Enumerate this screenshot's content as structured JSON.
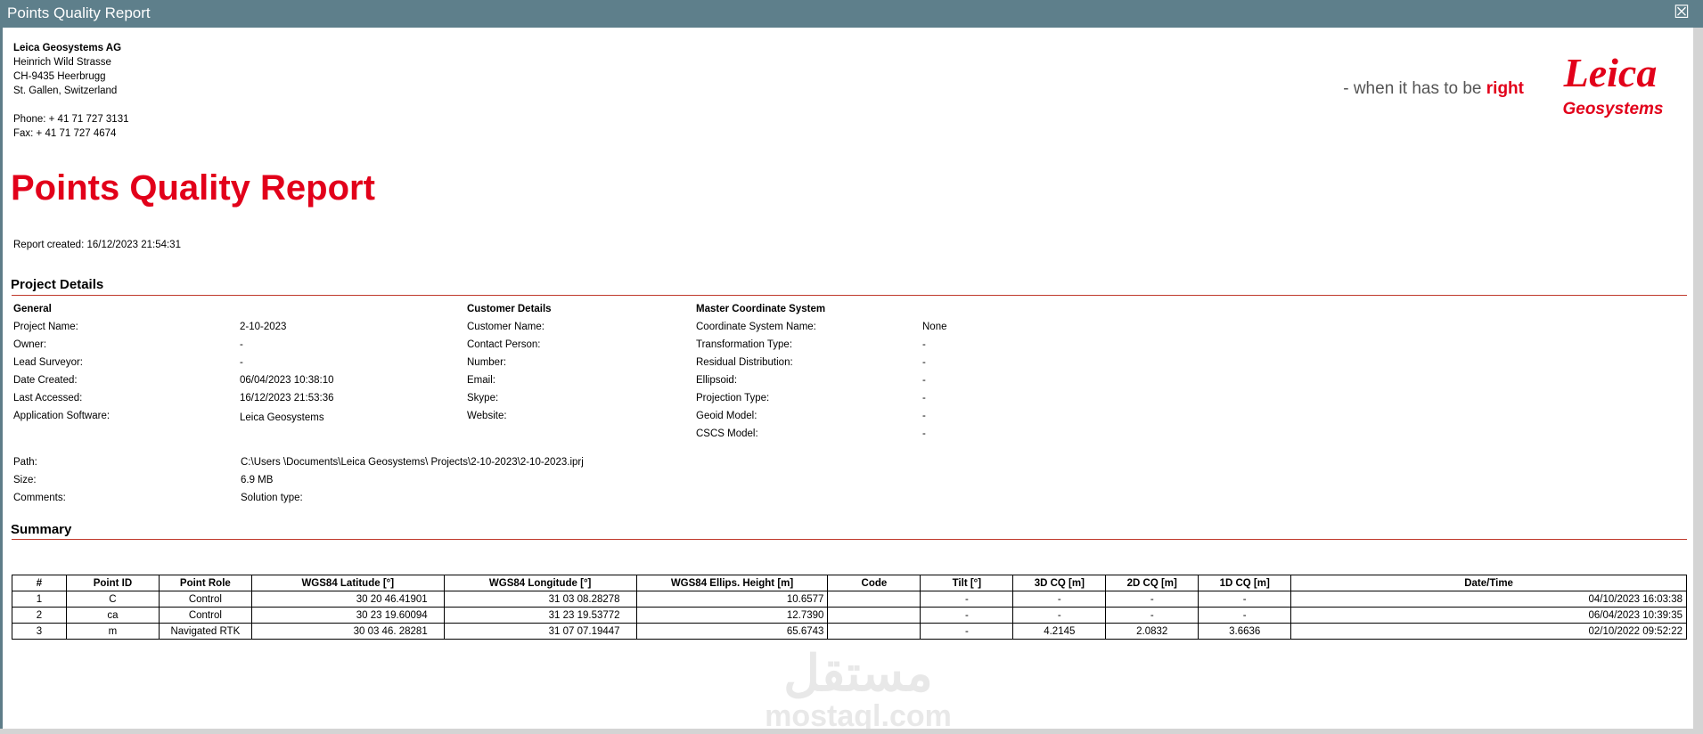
{
  "window": {
    "title": "Points Quality Report",
    "close": "☒"
  },
  "company": {
    "name": "Leica Geosystems AG",
    "lines": [
      "Heinrich Wild Strasse",
      "CH-9435 Heerbrugg",
      "St. Gallen, Switzerland"
    ],
    "phone": "Phone: + 41 71 727 3131",
    "fax": "Fax: + 41 71 727 4674"
  },
  "branding": {
    "slogan_prefix": "- when it has to be ",
    "slogan_emph": "right",
    "logo_word": "Leica",
    "logo_sub": "Geosystems",
    "accent": "#e2001a"
  },
  "report": {
    "title": "Points Quality Report",
    "created": "Report created: 16/12/2023 21:54:31"
  },
  "project_details": {
    "heading": "Project Details",
    "general": {
      "heading": "General",
      "rows": [
        {
          "label": "Project Name:",
          "value": "2-10-2023"
        },
        {
          "label": "Owner:",
          "value": "-"
        },
        {
          "label": "Lead Surveyor:",
          "value": "-"
        },
        {
          "label": "Date Created:",
          "value": "06/04/2023 10:38:10"
        },
        {
          "label": "Last Accessed:",
          "value": "16/12/2023 21:53:36"
        },
        {
          "label": "Application Software:",
          "value": "Leica Geosystems"
        }
      ]
    },
    "customer": {
      "heading": "Customer Details",
      "labels": [
        "Customer Name:",
        "Contact Person:",
        "Number:",
        "Email:",
        "Skype:",
        "Website:"
      ]
    },
    "master": {
      "heading": "Master Coordinate System",
      "rows": [
        {
          "label": "Coordinate System Name:",
          "value": "None"
        },
        {
          "label": "Transformation Type:",
          "value": "-"
        },
        {
          "label": "Residual Distribution:",
          "value": "-"
        },
        {
          "label": "Ellipsoid:",
          "value": "-"
        },
        {
          "label": "Projection Type:",
          "value": "-"
        },
        {
          "label": "Geoid Model:",
          "value": "-"
        },
        {
          "label": "CSCS Model:",
          "value": "-"
        }
      ]
    },
    "path_label": "Path:",
    "path_value": "C:\\Users \\Documents\\Leica Geosystems\\ Projects\\2-10-2023\\2-10-2023.iprj",
    "size_label": "Size:",
    "size_value": "6.9 MB",
    "comments_label": "Comments:",
    "solution_label": "Solution type:"
  },
  "summary": {
    "heading": "Summary",
    "columns": [
      "#",
      "Point ID",
      "Point Role",
      "WGS84 Latitude [°]",
      "WGS84 Longitude [°]",
      "WGS84 Ellips. Height [m]",
      "Code",
      "Tilt [°]",
      "3D CQ [m]",
      "2D CQ [m]",
      "1D CQ [m]",
      "Date/Time"
    ],
    "rows": [
      [
        "1",
        "C",
        "Control",
        "30 20 46.41901",
        "31 03 08.28278",
        "10.6577",
        "",
        "-",
        "-",
        "-",
        "-",
        "04/10/2023 16:03:38"
      ],
      [
        "2",
        "ca",
        "Control",
        "30 23 19.60094",
        "31 23 19.53772",
        "12.7390",
        "",
        "-",
        "-",
        "-",
        "-",
        "06/04/2023 10:39:35"
      ],
      [
        "3",
        "m",
        "Navigated RTK",
        "30 03 46. 28281",
        "31 07 07.19447",
        "65.6743",
        "",
        "-",
        "4.2145",
        "2.0832",
        "3.6636",
        "02/10/2022 09:52:22"
      ]
    ]
  },
  "watermark": {
    "arabic": "مستقل",
    "latin": "mostaql.com"
  }
}
